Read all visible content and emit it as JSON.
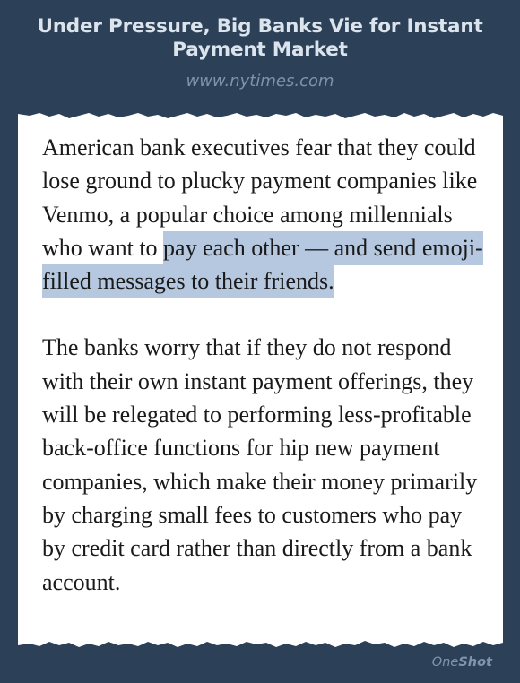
{
  "header": {
    "title": "Under Pressure, Big Banks Vie for Instant Payment Market",
    "source": "www.nytimes.com"
  },
  "article": {
    "paragraph1_plain": "American bank executives fear that they could lose ground to plucky payment companies like Venmo, a popular choice among millennials who want to ",
    "paragraph1_highlight": "pay each other — and send emoji-filled messages to their friends.",
    "paragraph2": "The banks worry that if they do not respond with their own instant payment offerings, they will be relegated to performing less-profitable back-office functions for hip new payment companies, which make their money primarily by charging small fees to customers who pay by credit card rather than directly from a bank account."
  },
  "watermark": {
    "part1": "One",
    "part2": "Shot"
  },
  "colors": {
    "background": "#2c4058",
    "paper": "#ffffff",
    "highlight": "#b5c8df"
  }
}
